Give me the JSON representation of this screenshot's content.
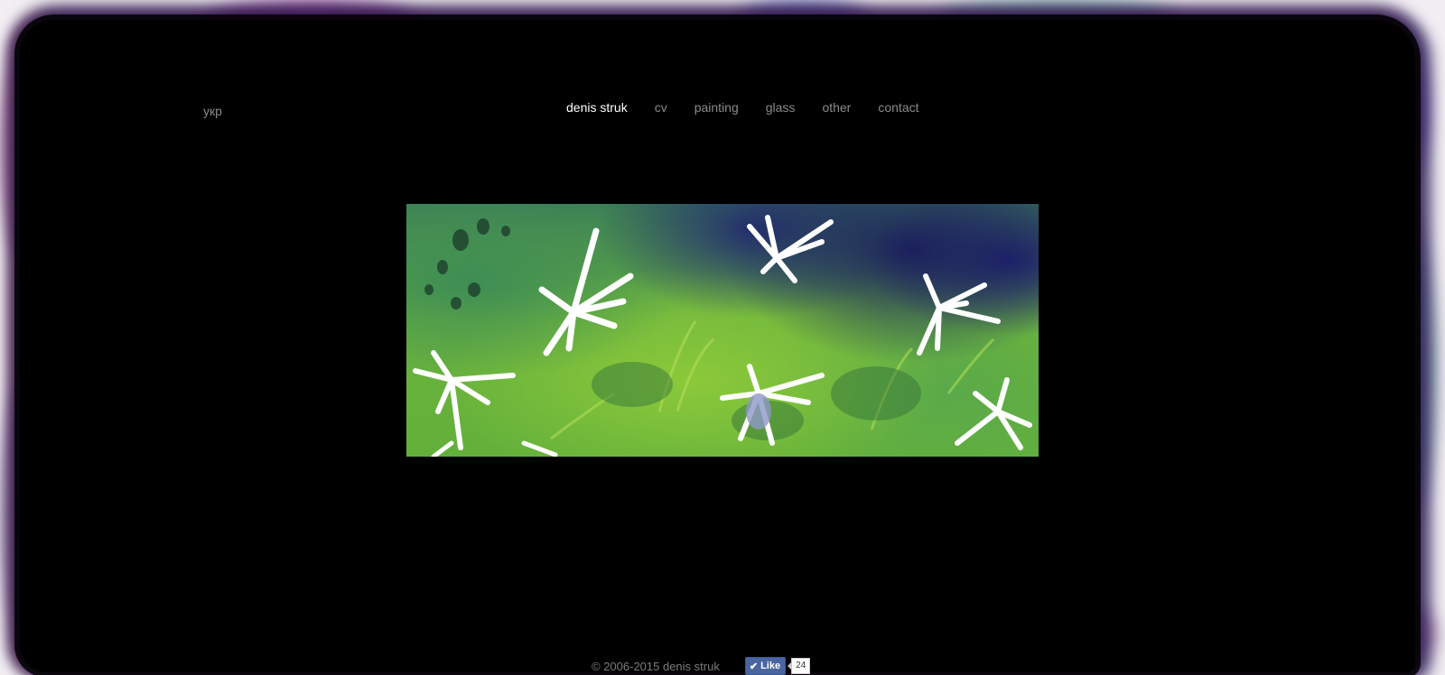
{
  "language_link": "укр",
  "nav": {
    "items": [
      {
        "label": "denis struk",
        "active": true
      },
      {
        "label": "cv",
        "active": false
      },
      {
        "label": "painting",
        "active": false
      },
      {
        "label": "glass",
        "active": false
      },
      {
        "label": "other",
        "active": false
      },
      {
        "label": "contact",
        "active": false
      }
    ]
  },
  "footer": {
    "copyright": "© 2006-2015 denis struk",
    "like_label": "Like",
    "like_count": "24"
  },
  "colors": {
    "background": "#000000",
    "nav_text": "#8a8a8a",
    "nav_active": "#ffffff",
    "like_button": "#4a66a0"
  },
  "icons": {
    "like": "check-icon"
  }
}
